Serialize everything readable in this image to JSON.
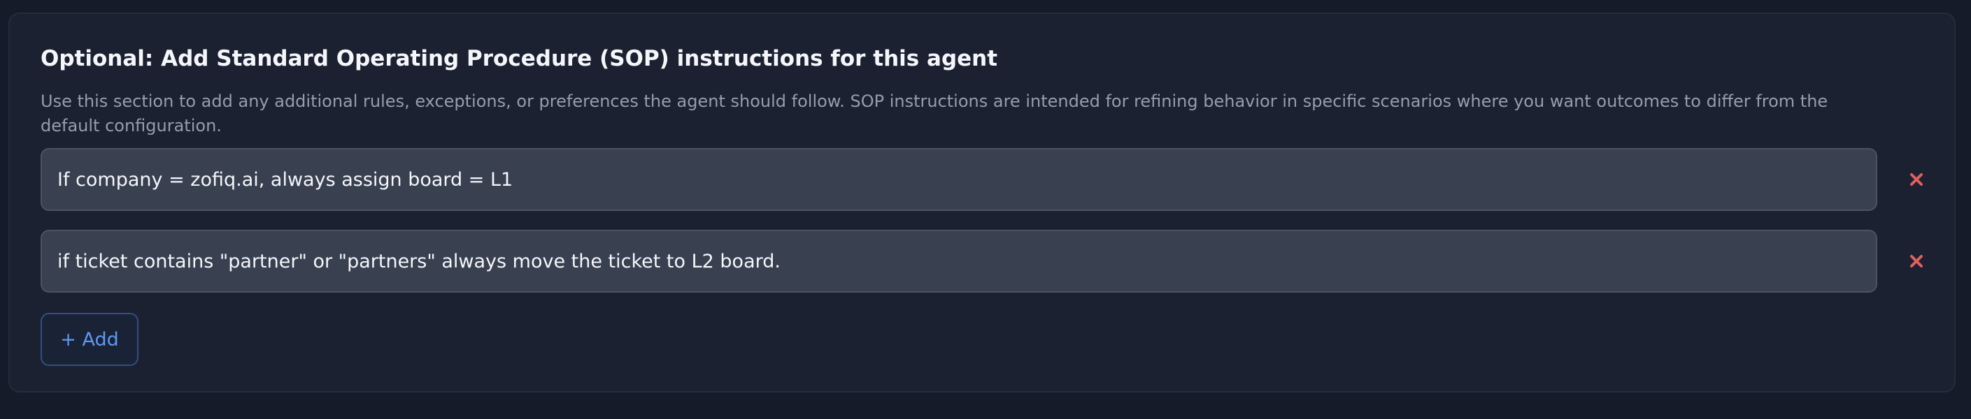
{
  "sop": {
    "title": "Optional: Add Standard Operating Procedure (SOP) instructions for this agent",
    "description": "Use this section to add any additional rules, exceptions, or preferences the agent should follow. SOP instructions are intended for refining behavior in specific scenarios where you want outcomes to differ from the default configuration.",
    "rules": [
      {
        "value": "If company = zofiq.ai, always assign board = L1",
        "remove_icon": "close-icon"
      },
      {
        "value": "if ticket contains \"partner\" or \"partners\" always move the ticket to L2 board.",
        "remove_icon": "close-icon"
      }
    ],
    "add_label": "+ Add"
  },
  "colors": {
    "page_background": "#151b28",
    "panel_background": "#1b2130",
    "input_background": "#394150",
    "remove_icon": "#e0605e",
    "accent": "#5e98f4"
  }
}
